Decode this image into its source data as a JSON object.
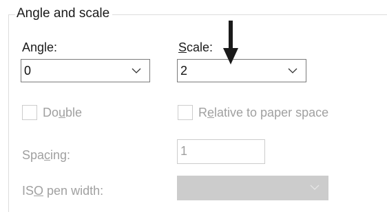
{
  "group": {
    "title": "Angle and scale"
  },
  "angle": {
    "label_pre": "An",
    "label_mnemonic": "g",
    "label_post": "le:",
    "value": "0"
  },
  "scale": {
    "label_mnemonic": "S",
    "label_post": "cale:",
    "value": "2"
  },
  "double": {
    "label_pre": "Do",
    "label_mnemonic": "u",
    "label_post": "ble",
    "checked": false,
    "enabled": false
  },
  "relative_to_paper_space": {
    "label_pre": "R",
    "label_mnemonic": "e",
    "label_post": "lative to paper space",
    "checked": false,
    "enabled": false
  },
  "spacing": {
    "label_pre": "Spa",
    "label_mnemonic": "c",
    "label_post": "ing:",
    "value": "1",
    "enabled": false
  },
  "iso_pen_width": {
    "label_pre": "IS",
    "label_mnemonic": "O",
    "label_post": " pen width:",
    "value": "",
    "enabled": false
  },
  "icons": {
    "dropdown": "chevron-down-icon",
    "annotation": "arrow-down-icon"
  },
  "colors": {
    "text": "#1a1a1a",
    "disabled_text": "#a0a0a0",
    "disabled_fill": "#cccccc",
    "border": "#7a7a7a",
    "arrow": "#1a1a1a"
  }
}
